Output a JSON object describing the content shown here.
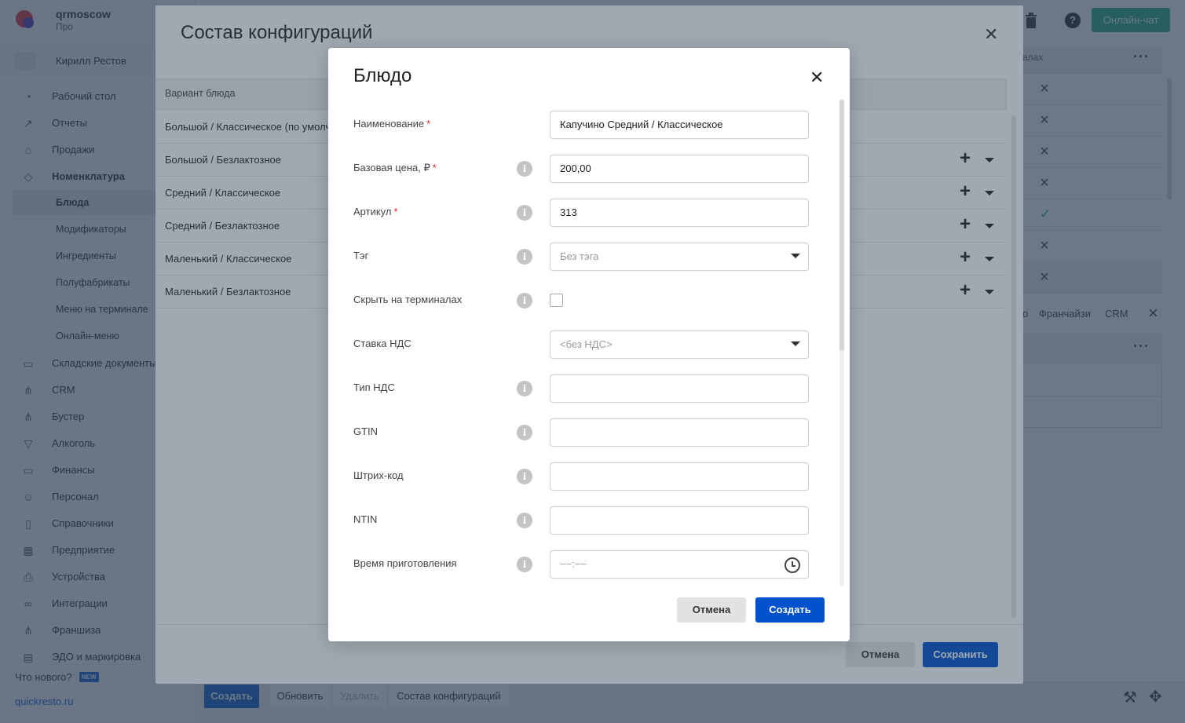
{
  "sidebar": {
    "org_name": "qrmoscow",
    "org_plan": "Про",
    "user_name": "Кирилл Рестов",
    "items": [
      {
        "label": "Рабочий стол",
        "icon": "dashboard-icon"
      },
      {
        "label": "Отчеты",
        "icon": "reports-icon"
      },
      {
        "label": "Продажи",
        "icon": "basket-icon"
      },
      {
        "label": "Номенклатура",
        "icon": "tag-icon"
      },
      {
        "label": "Складские документы",
        "icon": "warehouse-icon"
      },
      {
        "label": "CRM",
        "icon": "crm-icon"
      },
      {
        "label": "Бустер",
        "icon": "booster-icon"
      },
      {
        "label": "Алкоголь",
        "icon": "glass-icon"
      },
      {
        "label": "Финансы",
        "icon": "wallet-icon"
      },
      {
        "label": "Персонал",
        "icon": "people-icon"
      },
      {
        "label": "Справочники",
        "icon": "book-icon"
      },
      {
        "label": "Предприятие",
        "icon": "store-icon"
      },
      {
        "label": "Устройства",
        "icon": "printer-icon"
      },
      {
        "label": "Интеграции",
        "icon": "infinity-icon"
      },
      {
        "label": "Франшиза",
        "icon": "franchise-icon"
      },
      {
        "label": "ЭДО и маркировка",
        "icon": "document-icon"
      }
    ],
    "sub_items": [
      "Блюда",
      "Модификаторы",
      "Ингредиенты",
      "Полуфабрикаты",
      "Меню на терминале",
      "Онлайн-меню"
    ],
    "whats_new": "Что нового?",
    "new_badge": "NEW",
    "site_link": "quickresto.ru"
  },
  "topbar": {
    "chat_button": "Онлайн-чат",
    "help": "?"
  },
  "background_table": {
    "header_fragment": "алах",
    "marks": [
      "×",
      "×",
      "×",
      "×",
      "✓",
      "×",
      "×"
    ],
    "tabs": [
      "о",
      "Франчайзи",
      "CRM"
    ]
  },
  "bottom_bar": {
    "create": "Создать",
    "refresh": "Обновить",
    "delete": "Удалить",
    "composition": "Состав конфигураций"
  },
  "panel": {
    "title": "Состав конфигураций",
    "column_header": "Вариант блюда",
    "rows": [
      "Большой / Классическое (по умолчанию)",
      "Большой / Безлактозное",
      "Средний / Классическое",
      "Средний / Безлактозное",
      "Маленький / Классическое",
      "Маленький / Безлактозное"
    ],
    "cancel": "Отмена",
    "save": "Сохранить"
  },
  "dialog": {
    "title": "Блюдо",
    "fields": {
      "name": {
        "label": "Наименование",
        "value": "Капучино Средний / Классическое"
      },
      "price": {
        "label": "Базовая цена, ₽",
        "value": "200,00"
      },
      "sku": {
        "label": "Артикул",
        "value": "313"
      },
      "tag": {
        "label": "Тэг",
        "value": "Без тэга"
      },
      "hide": {
        "label": "Скрыть на терминалах"
      },
      "vat_rate": {
        "label": "Ставка НДС",
        "value": "<без НДС>"
      },
      "vat_type": {
        "label": "Тип НДС",
        "value": ""
      },
      "gtin": {
        "label": "GTIN",
        "value": ""
      },
      "barcode": {
        "label": "Штрих-код",
        "value": ""
      },
      "ntin": {
        "label": "NTIN",
        "value": ""
      },
      "cook_time": {
        "label": "Время приготовления",
        "placeholder": "−−:−−"
      }
    },
    "required_mark": "*",
    "info_glyph": "i",
    "cancel": "Отмена",
    "create": "Создать"
  },
  "colors": {
    "accent": "#0052cc",
    "chat": "#1aab72",
    "required": "#e0242a"
  }
}
